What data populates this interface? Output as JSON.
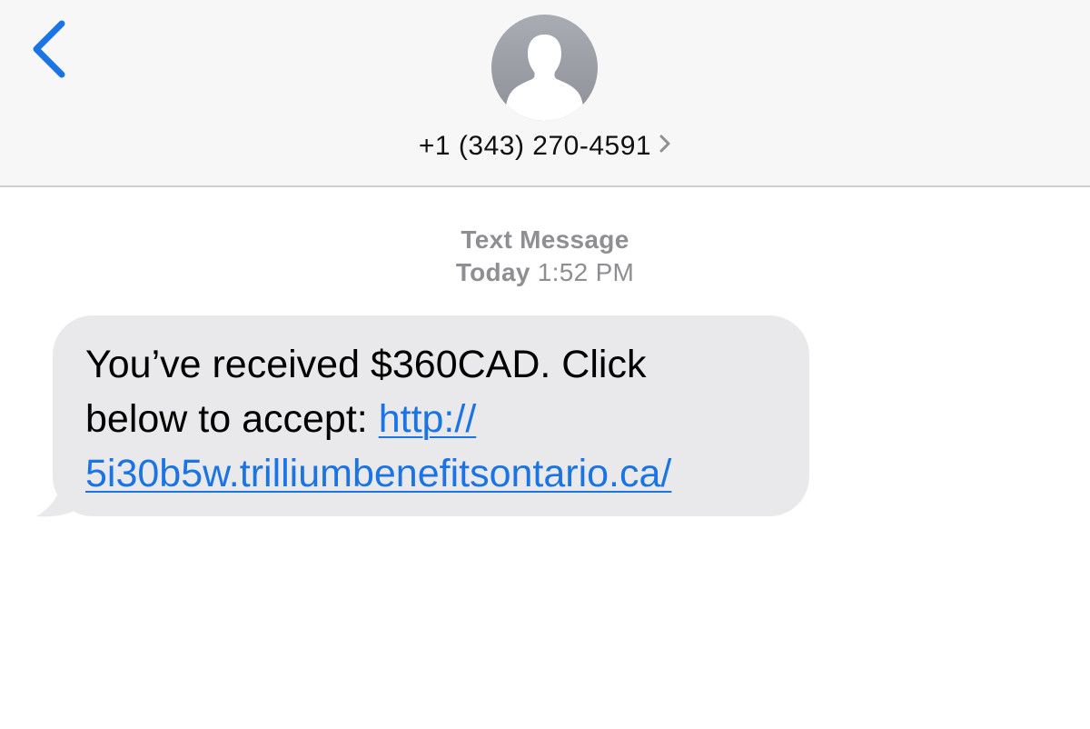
{
  "header": {
    "contact_name": "+1 (343) 270-4591"
  },
  "conversation": {
    "message_type": "Text Message",
    "day": "Today",
    "time": "1:52 PM"
  },
  "message": {
    "text_line1": "You’ve received $360CAD. Click",
    "text_line2_prefix": "below to accept:",
    "link_part1": "http://",
    "link_part2": "5i30b5w.trilliumbenefitsontario.ca/"
  },
  "colors": {
    "accent": "#1b74e4",
    "header_bg": "#f7f7f7",
    "bubble_bg": "#e9e9eb",
    "meta_text": "#8e8e93"
  },
  "icons": {
    "back": "chevron-left-icon",
    "avatar": "person-silhouette-icon",
    "disclosure": "chevron-right-icon"
  }
}
